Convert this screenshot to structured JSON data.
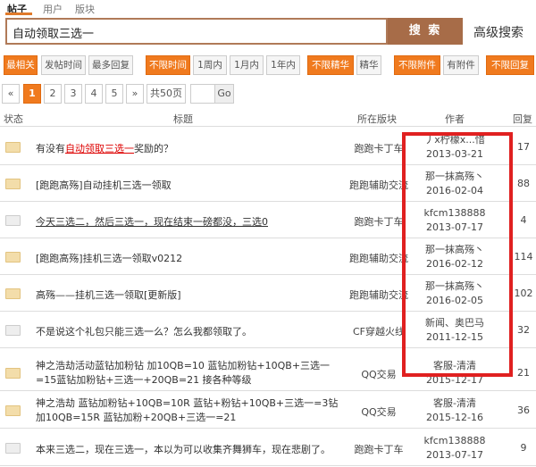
{
  "tabs": {
    "posts": "帖子",
    "users": "用户",
    "boards": "版块"
  },
  "search": {
    "query": "自动领取三选一",
    "button": "搜 索",
    "advanced": "高级搜索"
  },
  "filters": [
    "最相关",
    "发帖时间",
    "最多回复",
    "不限时间",
    "1周内",
    "1月内",
    "1年内",
    "不限精华",
    "精华",
    "不限附件",
    "有附件",
    "不限回复"
  ],
  "pager": {
    "prev": "«",
    "pages": [
      "1",
      "2",
      "3",
      "4",
      "5"
    ],
    "next": "»",
    "total": "共50页",
    "go": "Go"
  },
  "headers": {
    "status": "状态",
    "title": "标题",
    "board": "所在版块",
    "author": "作者",
    "reply": "回复"
  },
  "rows": [
    {
      "title_pre": "有没有",
      "title_kw": "自动领取三选一",
      "title_post": "奖励的？",
      "board": "跑跑卡丁车",
      "author": "丿x柠檬x...惜",
      "date": "2013-03-21",
      "reply": "17"
    },
    {
      "title": "[跑跑高殇]自动挂机三选一领取",
      "board": "跑跑辅助交流",
      "author": "那一抹高殇丶",
      "date": "2016-02-04",
      "reply": "88"
    },
    {
      "title": "今天三选二，然后三选一，现在结束一磅都没，三选0",
      "board": "跑跑卡丁车",
      "author": "kfcm138888",
      "date": "2013-07-17",
      "reply": "4"
    },
    {
      "title": "[跑跑高殇]挂机三选一领取v0212",
      "board": "跑跑辅助交流",
      "author": "那一抹高殇丶",
      "date": "2016-02-12",
      "reply": "114"
    },
    {
      "title": "高殇——挂机三选一领取[更新版]",
      "board": "跑跑辅助交流",
      "author": "那一抹高殇丶",
      "date": "2016-02-05",
      "reply": "102"
    },
    {
      "title": "不是说这个礼包只能三选一么？怎么我都领取了。",
      "board": "CF穿越火线",
      "author": "新闻、奥巴马",
      "date": "2011-12-15",
      "reply": "32"
    },
    {
      "title": "神之浩劫活动蓝钻加粉钻 加10QB=10 蓝钻加粉钻+10QB+三选一=15蓝钻加粉钻+三选一+20QB=21 接各种等级",
      "board": "QQ交易",
      "author": "客服-清清",
      "date": "2015-12-17",
      "reply": "21"
    },
    {
      "title": "神之浩劫 蓝钻加粉钻+10QB=10R 蓝钻+粉钻+10QB+三选一=3钻加10QB=15R 蓝钻加粉+20QB+三选一=21",
      "board": "QQ交易",
      "author": "客服-清清",
      "date": "2015-12-16",
      "reply": "36"
    },
    {
      "title": "本来三选二，现在三选一，本以为可以收集齐舞狮车，现在悲剧了。",
      "board": "跑跑卡丁车",
      "author": "kfcm138888",
      "date": "2013-07-17",
      "reply": "9"
    }
  ],
  "colors": {
    "accent": "#f07a1e",
    "search_border": "#b07a58",
    "highlight_box": "#e02020"
  }
}
